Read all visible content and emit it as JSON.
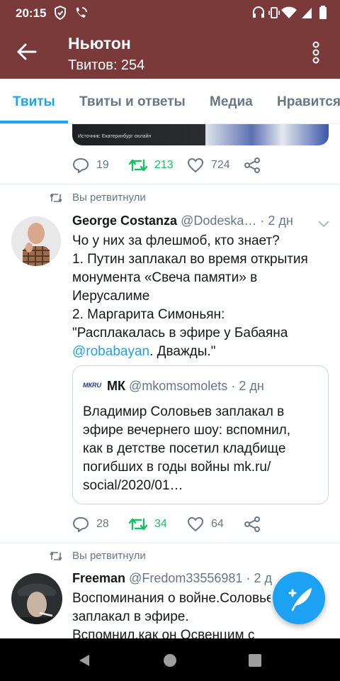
{
  "status_bar": {
    "time": "20:15"
  },
  "app_bar": {
    "title": "Ньютон",
    "subtitle": "Твитов: 254"
  },
  "tabs": [
    {
      "label": "Твиты",
      "active": true
    },
    {
      "label": "Твиты и ответы",
      "active": false
    },
    {
      "label": "Медиа",
      "active": false
    },
    {
      "label": "Нравится",
      "active": false
    }
  ],
  "tweet0": {
    "media_source": "Источник: Екатеринбург онлайн",
    "replies": "19",
    "retweets": "213",
    "likes": "724"
  },
  "tweet1": {
    "retweet_label": "Вы ретвитнули",
    "name": "George Costanza",
    "handle": "@Dodeska…",
    "time": "· 2 дн",
    "lines": [
      "Чо у них за флешмоб, кто знает?",
      "1. Путин заплакал во время открытия",
      "монумента «Свеча памяти» в",
      "Иерусалиме",
      "2. Маргарита Симоньян:",
      "\"Расплакалась в эфире у Бабаяна"
    ],
    "mention": "@robabayan",
    "tail": ". Дважды.\"",
    "quote": {
      "logo": "МКRU",
      "name": "МК",
      "handle": "@mkomsomolets",
      "time": "· 2 дн",
      "lines": [
        "Владимир Соловьев заплакал в",
        "эфире вечернего шоу: вспомнил,",
        "как в детстве посетил кладбище",
        "погибших в годы войны mk.ru/",
        "social/2020/01…"
      ]
    },
    "replies": "28",
    "retweets": "34",
    "likes": "64"
  },
  "tweet2": {
    "retweet_label": "Вы ретвитнули",
    "name": "Freeman",
    "handle": "@Fredom33556981",
    "time": "· 2 д",
    "lines": [
      "Воспоминания о войне.Соловьев",
      "заплакал в эфире.",
      "Вспомнил,как он Освенцим с"
    ]
  },
  "colors": {
    "bar": "#7a3a3a",
    "accent": "#1da1f2",
    "retweet": "#17bf63",
    "muted": "#657786"
  }
}
